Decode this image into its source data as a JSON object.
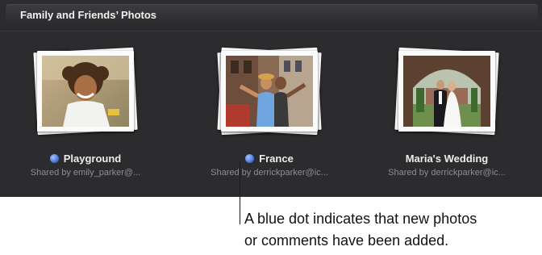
{
  "header": {
    "title": "Family and Friends’ Photos"
  },
  "albums": [
    {
      "title": "Playground",
      "shared": "Shared by emily_parker@...",
      "new_indicator": true
    },
    {
      "title": "France",
      "shared": "Shared by derrickparker@ic...",
      "new_indicator": true
    },
    {
      "title": "Maria's Wedding",
      "shared": "Shared by derrickparker@ic...",
      "new_indicator": false
    }
  ],
  "callout": {
    "line1": "A blue dot indicates that new photos",
    "line2": "or comments have been added."
  },
  "colors": {
    "panel": "#2c2c2e",
    "header": "#3a3a3d",
    "dot": "#4a78d9",
    "title": "#ececec",
    "subtitle": "#8e8e93"
  }
}
